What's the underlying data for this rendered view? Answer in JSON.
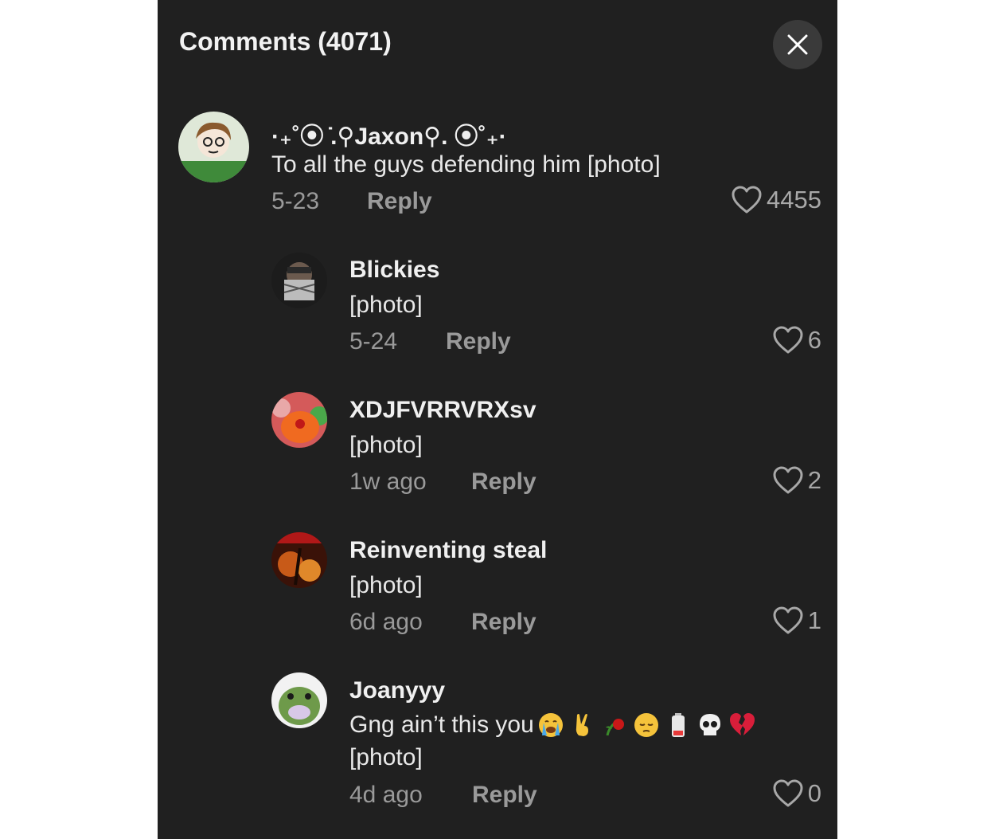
{
  "header": {
    "title": "Comments (4071)"
  },
  "comments": [
    {
      "username": "·₊˚⦿ ̇.⚲Jaxon⚲. ⦿˚₊·",
      "text": "To all the guys defending him [photo]",
      "date": "5-23",
      "reply_label": "Reply",
      "likes": "4455"
    },
    {
      "username": "Blickies",
      "text": "[photo]",
      "date": "5-24",
      "reply_label": "Reply",
      "likes": "6"
    },
    {
      "username": "XDJFVRRVRXsv",
      "text": "[photo]",
      "date": "1w ago",
      "reply_label": "Reply",
      "likes": "2"
    },
    {
      "username": "Reinventing steal",
      "text": "[photo]",
      "date": "6d ago",
      "reply_label": "Reply",
      "likes": "1"
    },
    {
      "username": "Joanyyy",
      "text": "Gng ain’t this you",
      "text2": "[photo]",
      "emojis": [
        "loudly-crying-face",
        "victory-hand",
        "wilted-flower",
        "pensive-face",
        "low-battery",
        "skull",
        "broken-heart"
      ],
      "date": "4d ago",
      "reply_label": "Reply",
      "likes": "0"
    }
  ]
}
